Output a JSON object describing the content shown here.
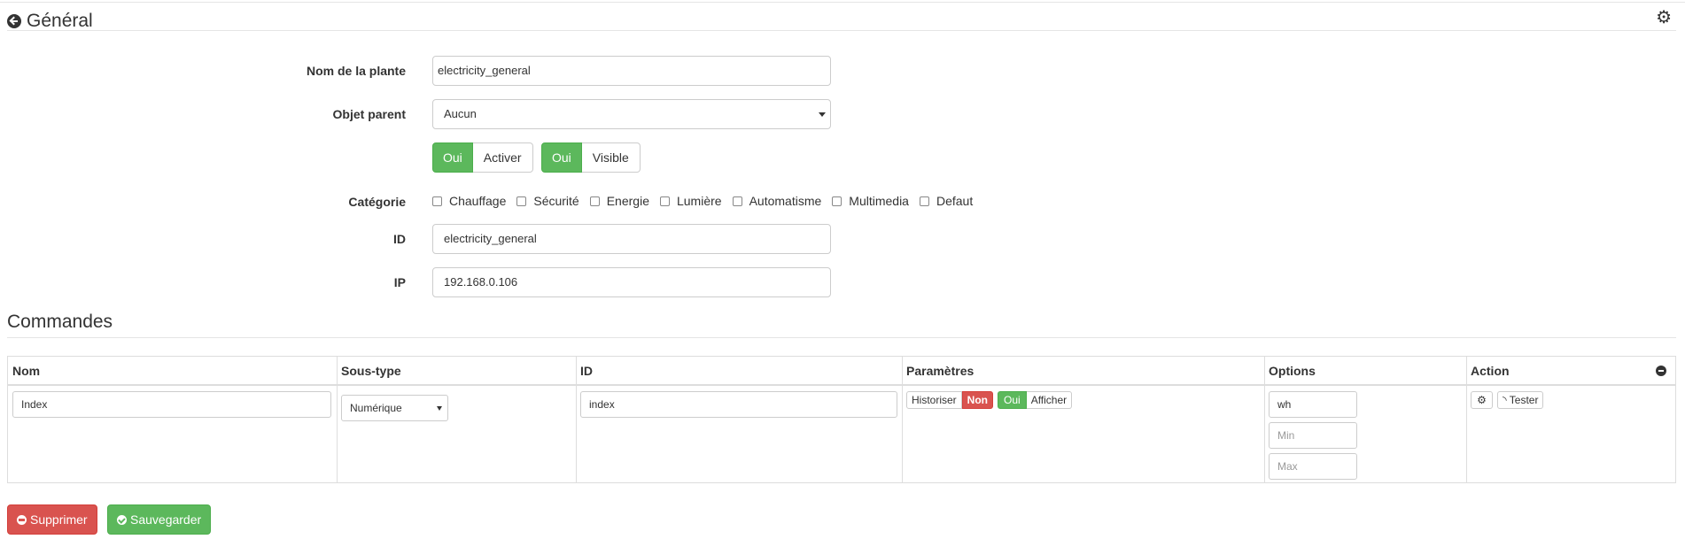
{
  "header": {
    "title": "Général",
    "settings_icon": "gears-icon"
  },
  "form": {
    "name_label": "Nom de la plante",
    "name_value": "electricity_general",
    "parent_label": "Objet parent",
    "parent_value": "Aucun",
    "activer_state": "Oui",
    "activer_label": "Activer",
    "visible_state": "Oui",
    "visible_label": "Visible",
    "category_label": "Catégorie",
    "categories": [
      "Chauffage",
      "Sécurité",
      "Energie",
      "Lumière",
      "Automatisme",
      "Multimedia",
      "Defaut"
    ],
    "id_label": "ID",
    "id_value": "electricity_general",
    "ip_label": "IP",
    "ip_value": "192.168.0.106"
  },
  "commands": {
    "title": "Commandes",
    "columns": [
      "Nom",
      "Sous-type",
      "ID",
      "Paramètres",
      "Options",
      "Action"
    ],
    "row": {
      "nom": "Index",
      "sous_type": "Numérique",
      "id": "index",
      "historiser_label": "Historiser",
      "historiser_state": "Non",
      "afficher_state": "Oui",
      "afficher_label": "Afficher",
      "unit": "wh",
      "min_placeholder": "Min",
      "max_placeholder": "Max",
      "tester_label": "Tester"
    }
  },
  "footer": {
    "delete_label": "Supprimer",
    "save_label": "Sauvegarder"
  },
  "colors": {
    "success": "#5cb85c",
    "danger": "#d9534f",
    "border": "#cccccc"
  }
}
